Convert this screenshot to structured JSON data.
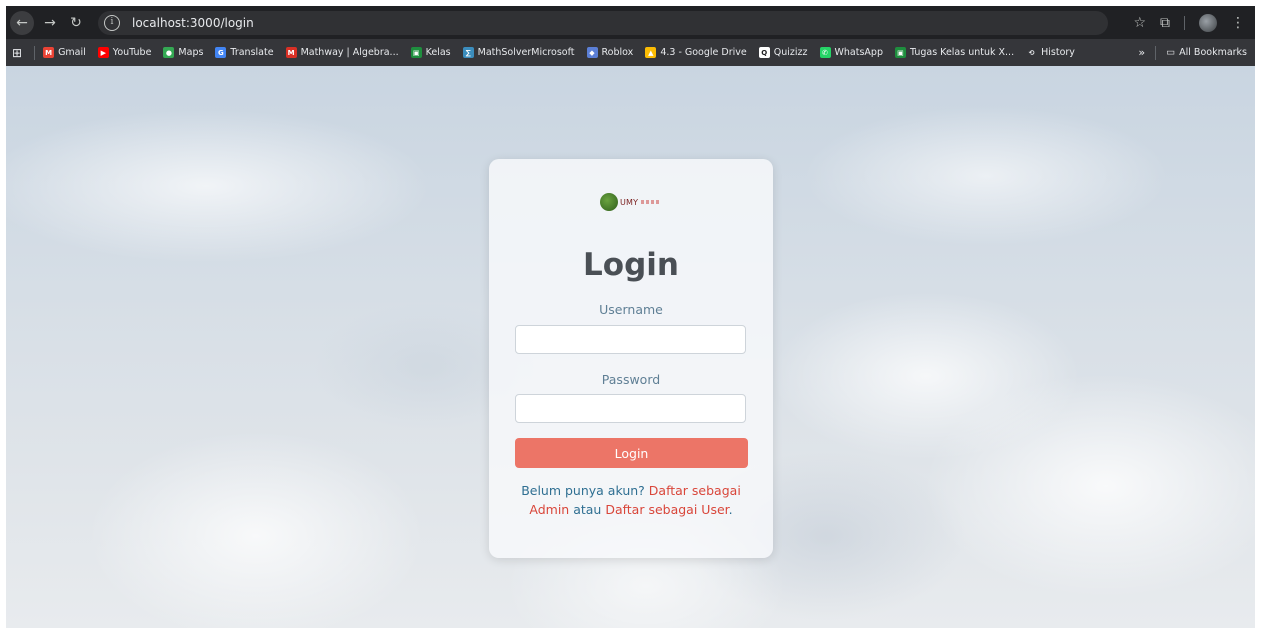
{
  "browser": {
    "url": "localhost:3000/login",
    "bookmarks": [
      {
        "label": "Gmail",
        "icon": "gmail-icon",
        "color": "#ea4335",
        "glyph": "M"
      },
      {
        "label": "YouTube",
        "icon": "youtube-icon",
        "color": "#ff0000",
        "glyph": "▶"
      },
      {
        "label": "Maps",
        "icon": "maps-icon",
        "color": "#34a853",
        "glyph": "●"
      },
      {
        "label": "Translate",
        "icon": "translate-icon",
        "color": "#4285f4",
        "glyph": "G"
      },
      {
        "label": "Mathway | Algebra...",
        "icon": "mathway-icon",
        "color": "#d93025",
        "glyph": "M"
      },
      {
        "label": "Kelas",
        "icon": "classroom-icon",
        "color": "#1e8e3e",
        "glyph": "▣"
      },
      {
        "label": "MathSolverMicrosoft",
        "icon": "mathsolver-icon",
        "color": "#3b8dbd",
        "glyph": "∑"
      },
      {
        "label": "Roblox",
        "icon": "roblox-icon",
        "color": "#5b7fd6",
        "glyph": "◆"
      },
      {
        "label": "4.3 - Google Drive",
        "icon": "google-drive-icon",
        "color": "#fbbc04",
        "glyph": "▲"
      },
      {
        "label": "Quizizz",
        "icon": "quizizz-icon",
        "color": "#ffffff",
        "glyph": "Q"
      },
      {
        "label": "WhatsApp",
        "icon": "whatsapp-icon",
        "color": "#25d366",
        "glyph": "✆"
      },
      {
        "label": "Tugas Kelas untuk X...",
        "icon": "classroom-icon",
        "color": "#1e8e3e",
        "glyph": "▣"
      },
      {
        "label": "History",
        "icon": "history-icon",
        "color": "transparent",
        "glyph": "⟲"
      }
    ],
    "more_label": "»",
    "all_bookmarks_label": "All Bookmarks"
  },
  "login": {
    "logo_text": "UMY",
    "title": "Login",
    "username_label": "Username",
    "password_label": "Password",
    "button_label": "Login",
    "prompt_text": "Belum punya akun? ",
    "admin_link": "Daftar sebagai Admin",
    "connector_text": " atau ",
    "user_link": "Daftar sebagai User",
    "end_text": "."
  },
  "colors": {
    "login_button": "#ec7567",
    "link": "#d9463a",
    "label": "#5f7f95"
  }
}
